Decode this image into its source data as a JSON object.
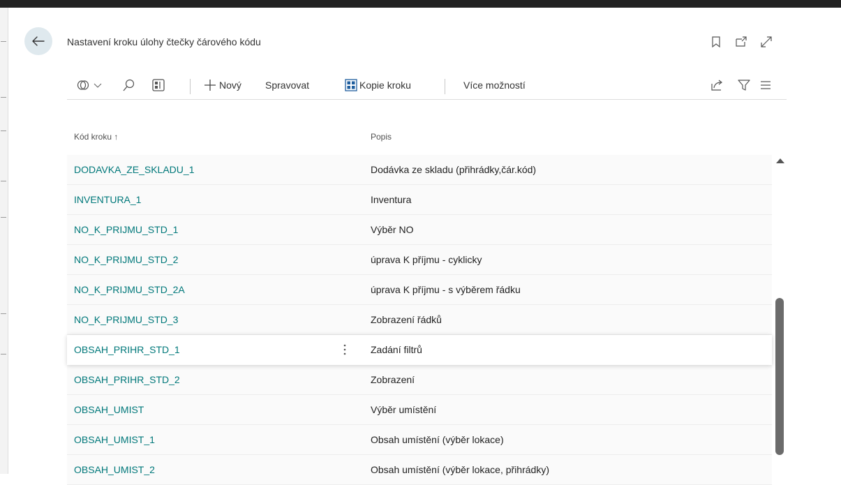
{
  "page": {
    "title": "Nastavení kroku úlohy čtečky čárového kódu"
  },
  "toolbar": {
    "new_label": "Nový",
    "manage_label": "Spravovat",
    "copy_step_label": "Kopie kroku",
    "more_options_label": "Více možností"
  },
  "list": {
    "columns": {
      "code": "Kód kroku",
      "sort_indicator": "↑",
      "desc": "Popis"
    },
    "rows": [
      {
        "code": "DODAVKA_ZE_SKLADU_1",
        "desc": "Dodávka ze skladu (přihrádky,čár.kód)"
      },
      {
        "code": "INVENTURA_1",
        "desc": "Inventura"
      },
      {
        "code": "NO_K_PRIJMU_STD_1",
        "desc": "Výběr NO"
      },
      {
        "code": "NO_K_PRIJMU_STD_2",
        "desc": "úprava K příjmu - cyklicky"
      },
      {
        "code": "NO_K_PRIJMU_STD_2A",
        "desc": "úprava K příjmu - s výběrem řádku"
      },
      {
        "code": "NO_K_PRIJMU_STD_3",
        "desc": "Zobrazení řádků"
      },
      {
        "code": "OBSAH_PRIHR_STD_1",
        "desc": "Zadání filtrů"
      },
      {
        "code": "OBSAH_PRIHR_STD_2",
        "desc": "Zobrazení"
      },
      {
        "code": "OBSAH_UMIST",
        "desc": "Výběr umístění"
      },
      {
        "code": "OBSAH_UMIST_1",
        "desc": "Obsah umístění (výběr lokace)"
      },
      {
        "code": "OBSAH_UMIST_2",
        "desc": "Obsah umístění (výběr lokace, přihrádky)"
      }
    ],
    "selected_row": 6
  },
  "icons": {
    "back": "back-arrow-icon",
    "bookmark": "bookmark-icon",
    "open_new": "open-in-new-window-icon",
    "expand": "expand-icon",
    "analyze": "analyze-icon",
    "search": "search-icon",
    "layout": "layout-icon",
    "plus": "plus-icon",
    "copy_step": "copy-step-icon",
    "share": "share-icon",
    "filter": "filter-icon",
    "list_view": "list-view-icon",
    "row_menu": "row-menu-icon",
    "scroll_up": "scroll-up-icon"
  },
  "colors": {
    "accent": "#00787a",
    "selected_row_bg": "#ffffff",
    "row_bg": "#fafafa"
  }
}
